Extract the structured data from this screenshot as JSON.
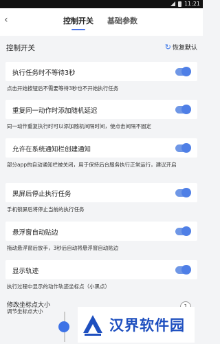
{
  "status_bar": {
    "time": "11:21"
  },
  "header": {
    "back_icon": "back-arrow",
    "tabs": [
      {
        "label": "控制开关",
        "active": true
      },
      {
        "label": "基础参数",
        "active": false
      }
    ]
  },
  "section": {
    "title": "控制开关",
    "restore_label": "恢复默认",
    "restore_icon": "refresh-icon"
  },
  "settings": [
    {
      "label": "执行任务时不等待3秒",
      "on": true,
      "description": "点击开始按钮后不需要等待3秒也不开始执行任务"
    },
    {
      "label": "重复同一动作时添加随机延迟",
      "on": true,
      "description": "同一动作重复执行时可以添加随机间隔时间，使点击间隔不固定"
    },
    {
      "label": "允许在系统通知栏创建通知",
      "on": true,
      "description": "部分app的自动通知栏被关闭，用于保持后台服务执行正常运行，建议开启"
    },
    {
      "label": "黑屏后停止执行任务",
      "on": true,
      "description": "手机锁屏后将停止当前的执行任务"
    },
    {
      "label": "悬浮窗自动贴边",
      "on": true,
      "description": "拖动悬浮窗后放手，3秒后自动将悬浮窗自动贴边"
    },
    {
      "label": "显示轨迹",
      "on": true,
      "description": "执行过程中显示的动作轨迹坐标点（小黑点）"
    }
  ],
  "point_size": {
    "title": "修改坐标点大小",
    "description": "调节坐标点大小",
    "value": "1"
  },
  "watermark": {
    "text": "汉界软件园"
  },
  "colors": {
    "accent": "#4f7fe6",
    "toggle_track": "#6f97e6",
    "background": "#f3f4f6"
  }
}
